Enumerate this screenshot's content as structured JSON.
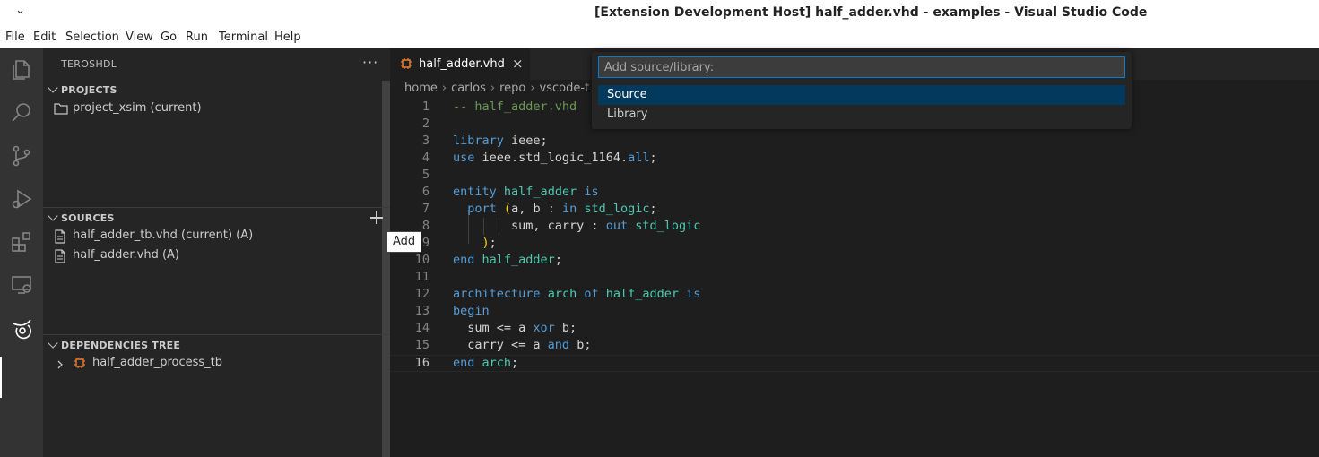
{
  "window": {
    "title": "[Extension Development Host] half_adder.vhd - examples - Visual Studio Code",
    "menu_chevron": "⌄"
  },
  "menu": [
    "File",
    "Edit",
    "Selection",
    "View",
    "Go",
    "Run",
    "Terminal",
    "Help"
  ],
  "activity_bar": {
    "icons": [
      "explorer-icon",
      "search-icon",
      "source-control-icon",
      "run-debug-icon",
      "extensions-icon",
      "remote-explorer-icon",
      "teroshdl-icon"
    ],
    "active": "teroshdl-icon"
  },
  "sidebar": {
    "title": "TEROSHDL",
    "more": "···",
    "projects": {
      "header": "PROJECTS",
      "items": [
        "project_xsim (current)"
      ]
    },
    "sources": {
      "header": "SOURCES",
      "items": [
        "half_adder_tb.vhd (current) (A)",
        "half_adder.vhd (A)"
      ],
      "add_tooltip": "Add"
    },
    "dependencies": {
      "header": "DEPENDENCIES TREE",
      "items": [
        "half_adder_process_tb"
      ]
    }
  },
  "editor": {
    "tab_label": "half_adder.vhd",
    "tab_close": "×",
    "breadcrumb": [
      "home",
      "carlos",
      "repo",
      "vscode-t"
    ],
    "current_line": 16
  },
  "quick_pick": {
    "placeholder": "Add source/library:",
    "options": [
      "Source",
      "Library"
    ],
    "selected": "Source"
  },
  "colors": {
    "accent": "#007fd4",
    "selection": "#04395e",
    "keyword": "#569cd6",
    "type": "#4ec9b0",
    "comment": "#6a9955",
    "vhdl_icon": "#e37933"
  }
}
